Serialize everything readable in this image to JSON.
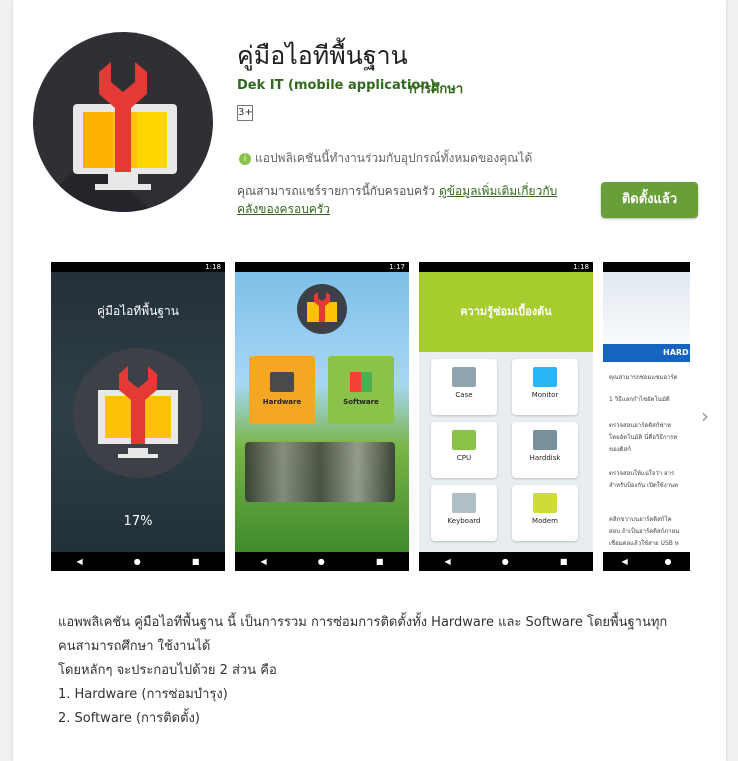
{
  "app": {
    "title": "คู่มือไอทีพื้นฐาน",
    "developer": "Dek IT (mobile application)",
    "category": "การศึกษา",
    "content_rating": "3+",
    "compat_note": "แอปพลิเคชันนี้ทำงานร่วมกับอุปกรณ์ทั้งหมดของคุณได้",
    "family_text": "คุณสามารถแชร์รายการนี้กับครอบครัว ",
    "family_link": "ดูข้อมูลเพิ่มเติมเกี่ยวกับคลังของครอบครัว",
    "install_label": "ติดตั้งแล้ว"
  },
  "screens": {
    "s1": {
      "time": "1:18",
      "title": "คู่มือไอทีพื้นฐาน",
      "progress": "17%"
    },
    "s2": {
      "time": "1:17",
      "tile_a": "Hardware",
      "tile_b": "Software"
    },
    "s3": {
      "time": "1:18",
      "header": "ความรู้ซ่อมเบื้องต้น",
      "items": [
        "Case",
        "Monitor",
        "CPU",
        "Harddisk",
        "Keyboard",
        "Modem"
      ]
    },
    "s4": {
      "header": "HARD",
      "lines": [
        "คุณสามารถซ่อมแซมฮาร์ด",
        "1 วิธีแลกกำไชอัตโนมัติ",
        "ตรวจสอบฮาร์ดดิสก์ฟาห",
        "โดยอัตโนมัติ นี่คือวิธีการท",
        "ของดิสก์",
        "ตรวจสอบให้แน่ใจว่า ฮาร",
        "สำหรับป้องกัน เปิดใช้งานค",
        "คลิกขวาบนฮาร์ดดิสก์โค",
        "สอบ ถ้าเป็นฮาร์ดดิสก์ภายน",
        "เชื่อมต่อแล้วใช้สาย USB ห"
      ]
    }
  },
  "description": {
    "line1": "แอพพลิเคชัน คู่มือไอทีพื้นฐาน นี้ เป็นการรวม การซ่อมการติดตั้งทั้ง Hardware และ Software โดยพื้นฐานทุก",
    "line2": "คนสามารถศึกษา ใช้งานได้",
    "line3": "โดยหลักๆ จะประกอบไปด้วย 2 ส่วน คือ",
    "line4": "1. Hardware (การซ่อมบำรุง)",
    "line5": "2. Software (การติดตั้ง)"
  },
  "colors": {
    "accent": "#689f38",
    "link": "#33691e"
  }
}
